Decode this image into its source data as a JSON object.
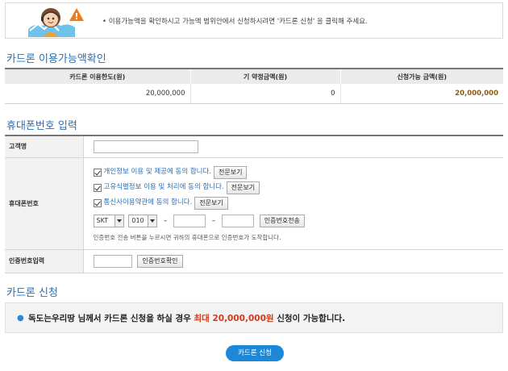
{
  "notice": {
    "illustration": "customer-service-agent",
    "warning_icon": "exclamation-triangle",
    "message": "• 이용가능액을 확인하시고 가능액 범위안에서 신청하시려면 '카드론 신청' 을 클릭해 주세요."
  },
  "limits_section": {
    "title": "카드론 이용가능액확인",
    "columns": [
      "카드론 이용한도(원)",
      "기 약정금액(원)",
      "신청가능 금액(원)"
    ],
    "values": [
      "20,000,000",
      "0",
      "20,000,000"
    ]
  },
  "phone_section": {
    "title": "휴대폰번호 입력",
    "customer_label": "고객명",
    "customer_value": "",
    "phone_label": "휴대폰번호",
    "agreements": [
      {
        "label": "개인정보 이용 및 제공에 동의 합니다.",
        "button": "전문보기",
        "checked": true
      },
      {
        "label": "고유식별정보 이용 및 처리에 동의 합니다.",
        "button": "전문보기",
        "checked": true
      },
      {
        "label": "통신사이용약관에 동의 합니다.",
        "button": "전문보기",
        "checked": true
      }
    ],
    "carrier": "SKT",
    "prefix": "010",
    "dash": "–",
    "middle": "",
    "last": "",
    "send_button": "인증번호전송",
    "hint": "인증번호 전송 버튼을 누르시면 귀하의 휴대폰으로 인증번호가 도착합니다.",
    "auth_label": "인증번호입력",
    "auth_value": "",
    "confirm_button": "인증번호확인"
  },
  "apply_section": {
    "title": "카드론 신청",
    "line_prefix": "독도는우리땅 님께서 카드론 신청을 하실 경우 ",
    "line_highlight": "최대 20,000,000원",
    "line_suffix": " 신청이 가능합니다.",
    "button": "카드론 신청"
  },
  "colors": {
    "accent": "#2a6fb5",
    "button": "#1e88d8",
    "highlight_red": "#d23a1b",
    "amount_brown": "#8b5a12"
  }
}
